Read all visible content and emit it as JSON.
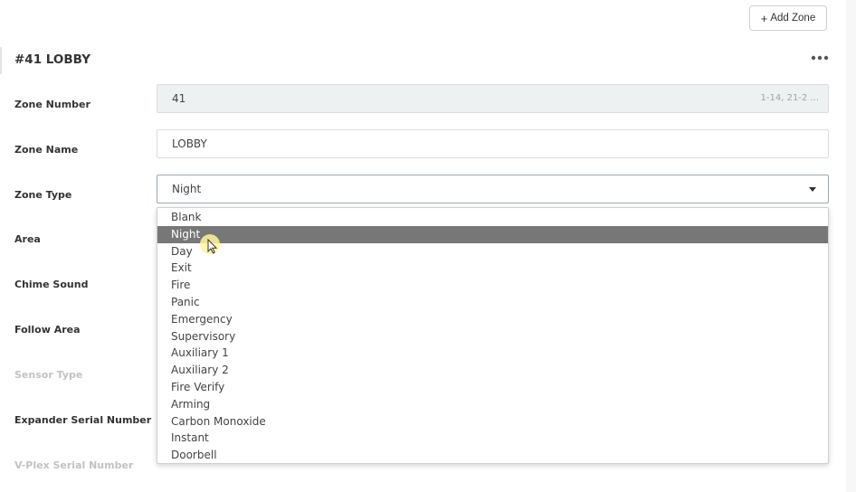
{
  "header": {
    "add_zone_label": "Add Zone",
    "add_zone_icon": "plus-icon"
  },
  "zone": {
    "title": "#41 LOBBY",
    "menu_icon": "more-horizontal-icon"
  },
  "fields": {
    "zone_number": {
      "label": "Zone Number",
      "value": "41",
      "hint": "1-14, 21-2 ..."
    },
    "zone_name": {
      "label": "Zone Name",
      "value": "LOBBY"
    },
    "zone_type": {
      "label": "Zone Type",
      "value": "Night"
    },
    "area": {
      "label": "Area"
    },
    "chime_sound": {
      "label": "Chime Sound"
    },
    "follow_area": {
      "label": "Follow Area"
    },
    "sensor_type": {
      "label": "Sensor Type"
    },
    "expander_serial": {
      "label": "Expander Serial Number"
    },
    "vplex_serial": {
      "label": "V-Plex Serial Number"
    }
  },
  "zone_type_options": [
    "Blank",
    "Night",
    "Day",
    "Exit",
    "Fire",
    "Panic",
    "Emergency",
    "Supervisory",
    "Auxiliary 1",
    "Auxiliary 2",
    "Fire Verify",
    "Arming",
    "Carbon Monoxide",
    "Instant",
    "Doorbell"
  ],
  "selected_option": "Night",
  "colors": {
    "highlight": "#777777",
    "cursor_halo": "#fff59a"
  }
}
